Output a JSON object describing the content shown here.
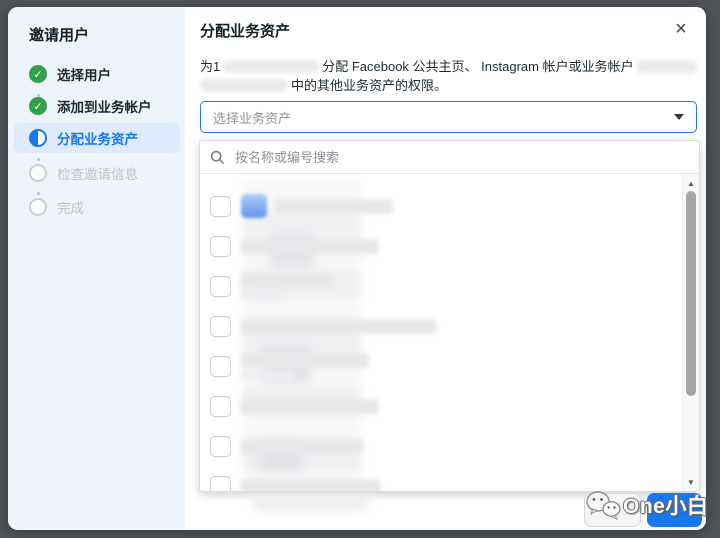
{
  "window": {
    "overlay_background": "#515559",
    "dialog_background": "#ffffff"
  },
  "sidebar": {
    "title": "邀请用户",
    "steps": [
      {
        "label": "选择用户",
        "state": "completed"
      },
      {
        "label": "添加到业务帐户",
        "state": "completed"
      },
      {
        "label": "分配业务资产",
        "state": "current"
      },
      {
        "label": "检查邀请信息",
        "state": "pending"
      },
      {
        "label": "完成",
        "state": "pending"
      }
    ]
  },
  "header": {
    "title": "分配业务资产"
  },
  "description": {
    "part1": "为1",
    "redacted1": "(已打码的用户名)",
    "part2": "分配 Facebook 公共主页、 Instagram 帐户或业务帐户",
    "redacted2": "(已打码的业务帐户名)",
    "part3": "中的其他业务资产的权限。"
  },
  "asset_select": {
    "placeholder": "选择业务资产"
  },
  "search": {
    "placeholder": "按名称或编号搜索"
  },
  "list": {
    "rows": [
      {
        "redacted": true,
        "avatar": "#5e96e8",
        "bar": 118
      },
      {
        "redacted": true,
        "bar": 138
      },
      {
        "redacted": true,
        "bar": 92,
        "bar2": 46
      },
      {
        "redacted": true,
        "bar": 196
      },
      {
        "redacted": true,
        "bar": 128,
        "bar2": 54
      },
      {
        "redacted": true,
        "bar": 138
      },
      {
        "redacted": true,
        "bar": 122
      },
      {
        "redacted": true,
        "bar": 140
      }
    ]
  },
  "footer": {
    "secondary_button_label": "",
    "primary_button_label": ""
  },
  "watermark": {
    "text": "One小白"
  },
  "icons": {
    "close": "×",
    "check": "✓",
    "scroll_up": "▲",
    "scroll_down": "▼"
  },
  "colors": {
    "accent_blue": "#1877f2",
    "success_green": "#31a24c",
    "sidebar_background": "#eff4fa",
    "current_step_highlight": "#dfeafc",
    "select_border_focus": "#2478e4",
    "pending_gray": "#bdc3c9"
  }
}
